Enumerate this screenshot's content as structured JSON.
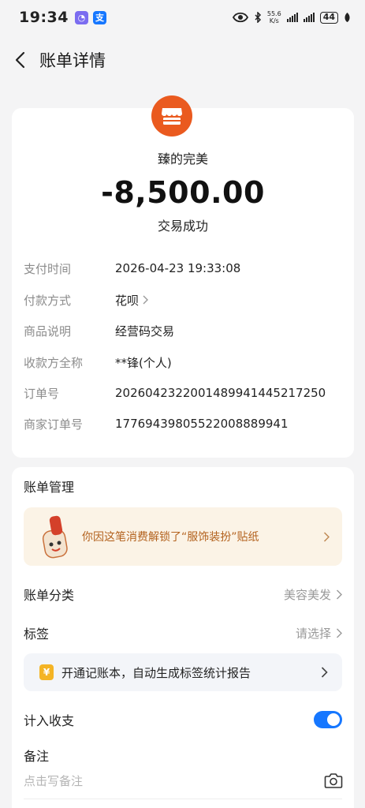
{
  "status_bar": {
    "time": "19:34",
    "network_speed_value": "55.6",
    "network_speed_unit": "K/s",
    "battery": "44"
  },
  "nav": {
    "title": "账单详情"
  },
  "bill": {
    "merchant_name": "臻的完美",
    "amount": "-8,500.00",
    "status": "交易成功",
    "details": [
      {
        "label": "支付时间",
        "value": "2026-04-23 19:33:08"
      },
      {
        "label": "付款方式",
        "value": "花呗"
      },
      {
        "label": "商品说明",
        "value": "经营码交易"
      },
      {
        "label": "收款方全称",
        "value": "**锋(个人)"
      },
      {
        "label": "订单号",
        "value": "2026042322001489941445217250"
      },
      {
        "label": "商家订单号",
        "value": "17769439805522008889941"
      }
    ]
  },
  "management": {
    "title": "账单管理",
    "sticker_banner_text": "你因这笔消费解锁了“服饰装扮”贴纸",
    "category_label": "账单分类",
    "category_value": "美容美发",
    "tag_label": "标签",
    "tag_value": "请选择",
    "promo_text": "开通记账本，自动生成标签统计报告",
    "count_label": "计入收支",
    "count_enabled": true,
    "note_label": "备注",
    "note_placeholder": "点击写备注"
  },
  "colors": {
    "merchant_logo": "#ea5a1f",
    "toggle_on": "#1677ff",
    "sticker_text": "#b3621e",
    "promo_icon": "#f4b425"
  },
  "icons": [
    "back-icon",
    "store-icon",
    "chevron-right-icon",
    "camera-icon",
    "eye-icon",
    "bluetooth-icon",
    "signal-icon",
    "leaf-icon"
  ]
}
